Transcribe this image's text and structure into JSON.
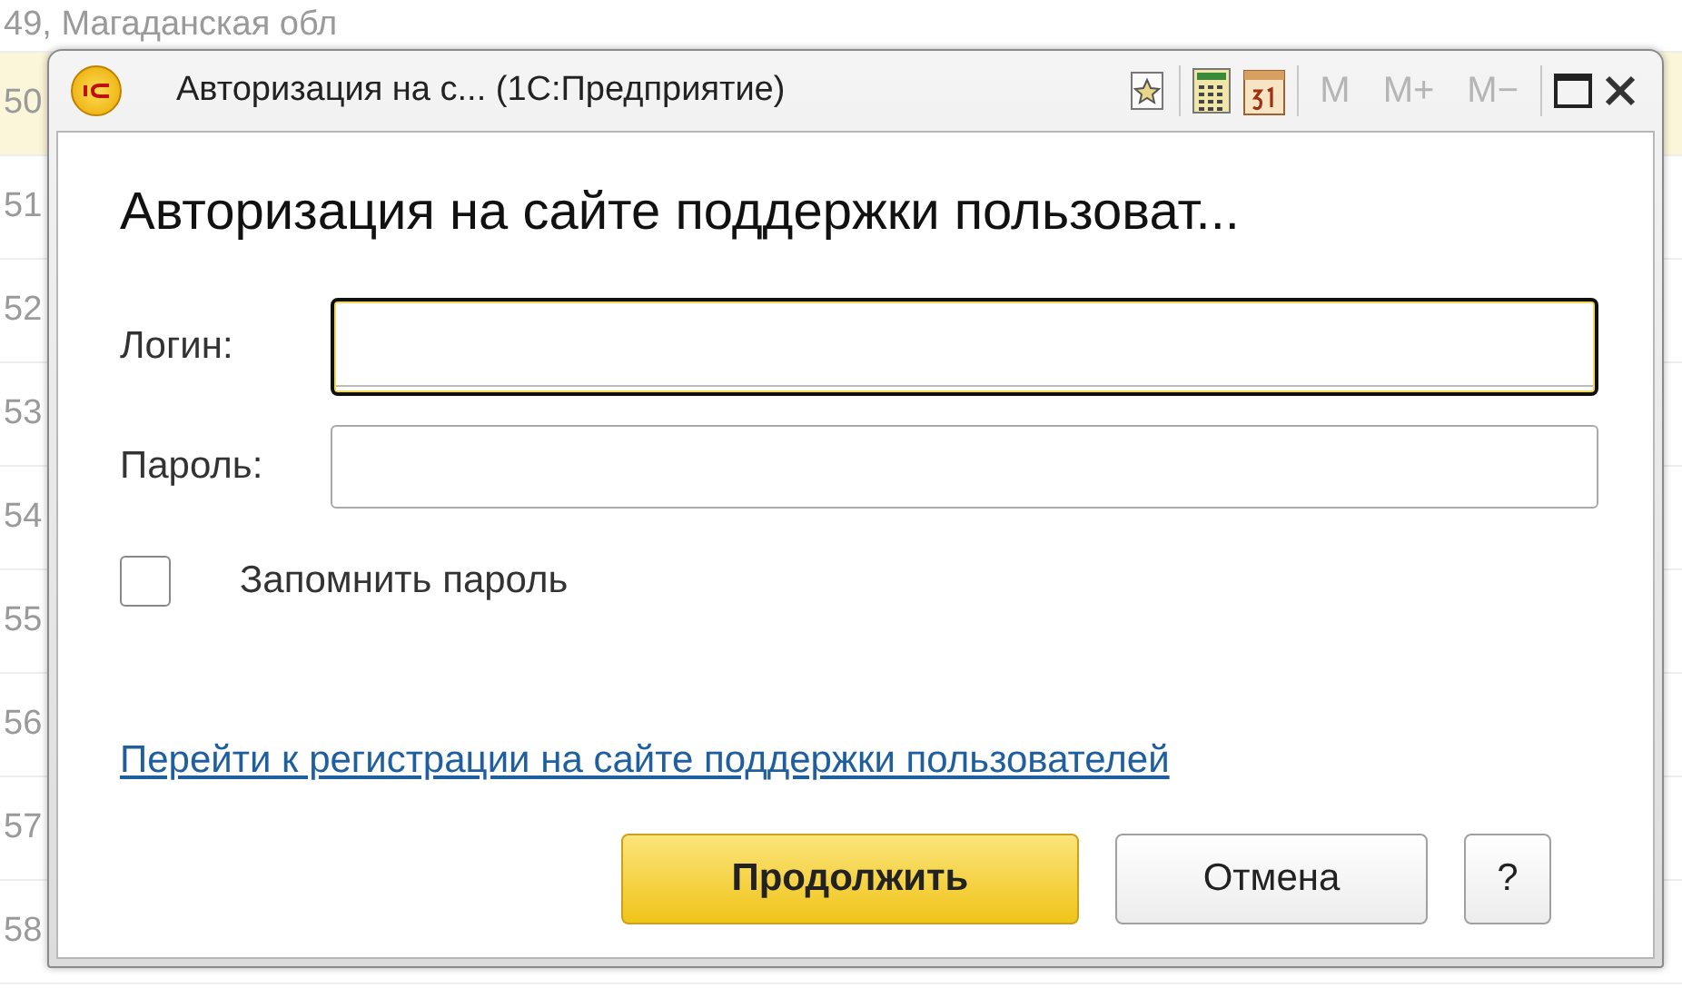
{
  "background_list": {
    "rows": [
      {
        "text": "49, Магаданская обл",
        "selected": false
      },
      {
        "text": "50",
        "selected": true
      },
      {
        "text": "51",
        "selected": false
      },
      {
        "text": "52",
        "selected": false
      },
      {
        "text": "53",
        "selected": false
      },
      {
        "text": "54",
        "selected": false
      },
      {
        "text": "55",
        "selected": false
      },
      {
        "text": "56",
        "selected": false
      },
      {
        "text": "57",
        "selected": false
      },
      {
        "text": "58",
        "selected": false
      }
    ]
  },
  "window": {
    "title": "Авторизация на с... (1С:Предприятие)",
    "toolbar": [
      {
        "kind": "favorite"
      },
      {
        "kind": "calculator"
      },
      {
        "kind": "calendar"
      },
      {
        "kind": "memory",
        "label": "M",
        "disabled": true
      },
      {
        "kind": "memory",
        "label": "M+",
        "disabled": true
      },
      {
        "kind": "memory",
        "label": "M−",
        "disabled": true
      },
      {
        "kind": "maximize"
      },
      {
        "kind": "close"
      }
    ]
  },
  "form": {
    "heading": "Авторизация на сайте поддержки пользоват...",
    "fields": [
      {
        "label": "Логин:",
        "focused": true
      },
      {
        "label": "Пароль:",
        "focused": false
      }
    ],
    "remember": {
      "label": "Запомнить пароль",
      "checked": false
    },
    "link": "Перейти к регистрации на сайте поддержки пользователей",
    "buttons": [
      {
        "label": "Продолжить",
        "kind": "default"
      },
      {
        "label": "Отмена",
        "kind": "normal"
      },
      {
        "label": "?",
        "kind": "help"
      }
    ]
  }
}
